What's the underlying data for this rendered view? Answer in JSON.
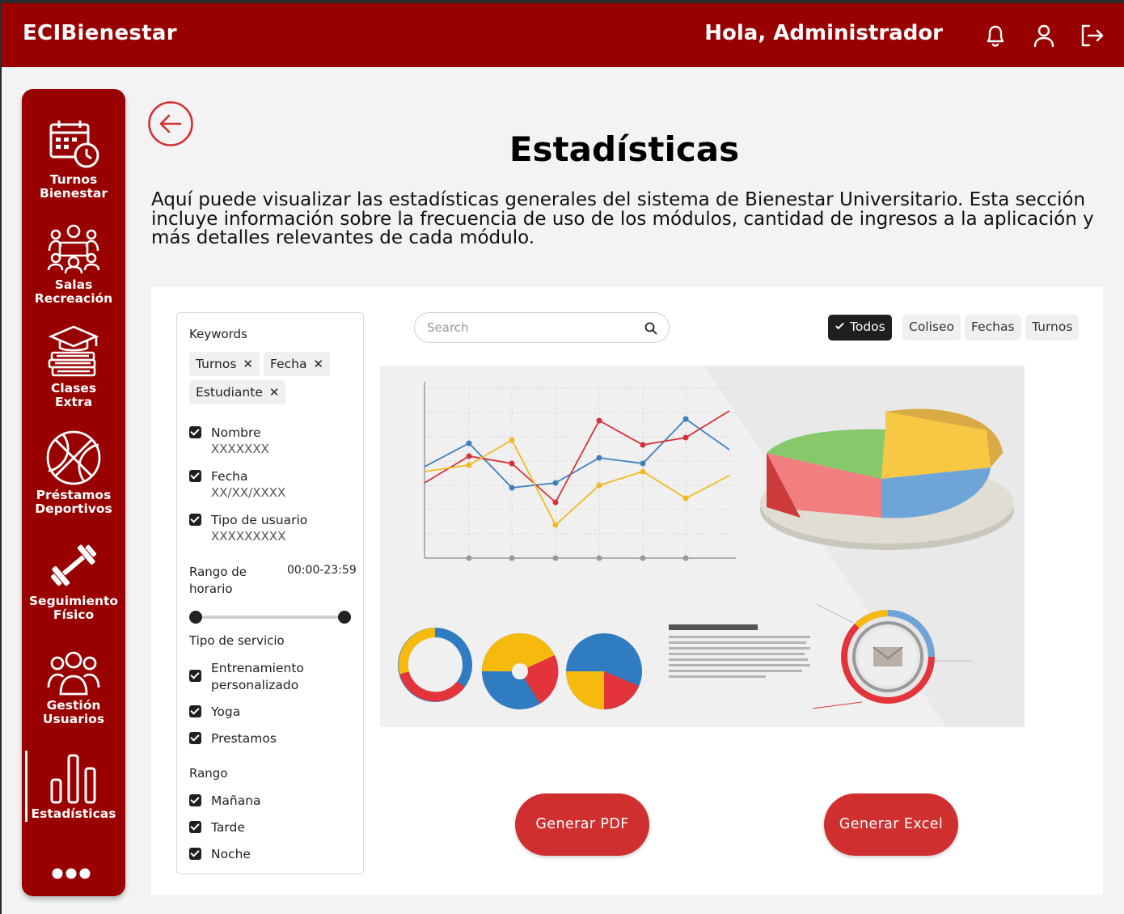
{
  "header": {
    "brand": "ECIBienestar",
    "greeting": "Hola, Administrador",
    "icons": [
      "bell-icon",
      "user-icon",
      "logout-icon"
    ]
  },
  "sidebar": {
    "items": [
      {
        "line1": "Turnos",
        "line2": "Bienestar",
        "icon": "calendar-clock-icon"
      },
      {
        "line1": "Salas",
        "line2": "Recreación",
        "icon": "meeting-room-icon"
      },
      {
        "line1": "Clases",
        "line2": "Extra",
        "icon": "books-graduation-icon"
      },
      {
        "line1": "Préstamos",
        "line2": "Deportivos",
        "icon": "basketball-icon"
      },
      {
        "line1": "Seguimiento",
        "line2": "Físico",
        "icon": "dumbbell-icon"
      },
      {
        "line1": "Gestión",
        "line2": "Usuarios",
        "icon": "users-group-icon"
      },
      {
        "line1": "Estadísticas",
        "line2": "",
        "icon": "bar-chart-icon"
      }
    ],
    "active": "Estadísticas"
  },
  "page": {
    "title": "Estadísticas",
    "description": "Aquí puede visualizar las estadísticas generales del sistema de Bienestar Universitario. Esta sección incluye información sobre la frecuencia de uso de los módulos, cantidad de ingresos a la aplicación y más detalles relevantes de cada módulo."
  },
  "filters": {
    "keywords_label": "Keywords",
    "chips": [
      "Turnos",
      "Fecha",
      "Estudiante"
    ],
    "fields": [
      {
        "label": "Nombre",
        "value": "XXXXXXX"
      },
      {
        "label": "Fecha",
        "value": "XX/XX/XXXX"
      },
      {
        "label": "Tipo de usuario",
        "value": "XXXXXXXXX"
      }
    ],
    "range_label_1": "Rango de",
    "range_label_2": "horario",
    "range_value": "00:00-23:59",
    "service_label": "Tipo de servicio",
    "services": [
      "Entrenamiento",
      "personalizado",
      "Yoga",
      "Prestamos"
    ],
    "rango_label": "Rango",
    "rangos": [
      "Mañana",
      "Tarde",
      "Noche"
    ]
  },
  "search": {
    "placeholder": "Search"
  },
  "tags": [
    "Todos",
    "Coliseo",
    "Fechas",
    "Turnos"
  ],
  "buttons": {
    "pdf": "Generar PDF",
    "excel": "Generar Excel"
  },
  "colors": {
    "brand": "#990000",
    "button": "#cf2f2f"
  }
}
